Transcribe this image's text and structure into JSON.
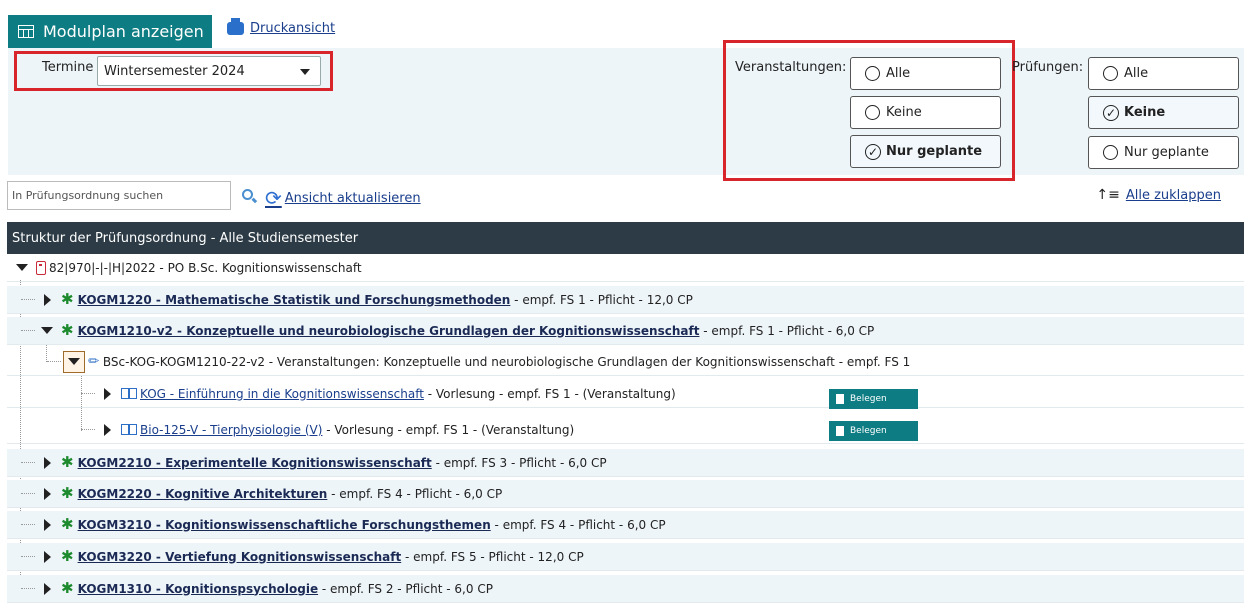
{
  "header": {
    "tab_label": "Modulplan anzeigen",
    "print_label": "Druckansicht"
  },
  "filters": {
    "termine_label": "Termine",
    "termine_value": "Wintersemester 2024",
    "veranstaltungen_label": "Veranstaltungen:",
    "pruefungen_label": "Prüfungen:",
    "veranstaltungen_options": [
      "Alle",
      "Keine",
      "Nur geplante"
    ],
    "veranstaltungen_selected": "Nur geplante",
    "pruefungen_options": [
      "Alle",
      "Keine",
      "Nur geplante"
    ],
    "pruefungen_selected": "Keine"
  },
  "toolbar": {
    "search_placeholder": "In Prüfungsordnung suchen",
    "refresh_label": "Ansicht aktualisieren",
    "collapse_label": "Alle zuklappen"
  },
  "table": {
    "header": "Struktur der Prüfungsordnung - Alle Studiensemester",
    "root": "82|970|-|-|H|2022 - PO B.Sc. Kognitionswissenschaft",
    "rows": [
      {
        "link": "KOGM1220 - Mathematische Statistik und Forschungsmethoden",
        "meta": " - empf. FS 1 - Pflicht - 12,0 CP"
      },
      {
        "link": "KOGM1210-v2 - Konzeptuelle und neurobiologische Grundlagen der Kognitionswissenschaft",
        "meta": " - empf. FS 1 - Pflicht - 6,0 CP"
      },
      {
        "text": "BSc-KOG-KOGM1210-22-v2 - Veranstaltungen: Konzeptuelle und neurobiologische Grundlagen der Kognitionswissenschaft - empf. FS 1"
      },
      {
        "link": "KOG - Einführung in die Kognitionswissenschaft",
        "meta": " - Vorlesung - empf. FS 1 - (Veranstaltung)",
        "action": "Belegen"
      },
      {
        "link": "Bio-125-V - Tierphysiologie (V)",
        "meta": " - Vorlesung - empf. FS 1 - (Veranstaltung)",
        "action": "Belegen"
      },
      {
        "link": "KOGM2210 - Experimentelle Kognitionswissenschaft",
        "meta": " - empf. FS 3 - Pflicht - 6,0 CP"
      },
      {
        "link": "KOGM2220 - Kognitive Architekturen",
        "meta": " - empf. FS 4 - Pflicht - 6,0 CP"
      },
      {
        "link": "KOGM3210 - Kognitionswissenschaftliche Forschungsthemen",
        "meta": " - empf. FS 4 - Pflicht - 6,0 CP"
      },
      {
        "link": "KOGM3220 - Vertiefung Kognitionswissenschaft",
        "meta": " - empf. FS 5 - Pflicht - 12,0 CP"
      },
      {
        "link": "KOGM1310 - Kognitionspsychologie",
        "meta": " - empf. FS 2 - Pflicht - 6,0 CP"
      }
    ]
  },
  "icons": {
    "tab": "calendar-grid-icon",
    "print": "printer-icon",
    "search": "magnifier-icon",
    "refresh": "refresh-icon",
    "collapse": "collapse-all-icon",
    "po": "document-icon",
    "module": "puzzle-icon",
    "course_group": "tag-icon",
    "course": "book-icon",
    "action": "door-icon"
  },
  "colors": {
    "accent": "#0e7c83",
    "highlight": "#d8242b",
    "header_bg": "#2c3b45",
    "module_icon": "#1d8a2e"
  }
}
